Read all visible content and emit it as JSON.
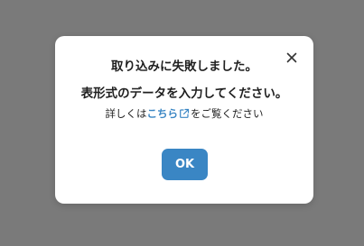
{
  "dialog": {
    "title": "取り込みに失敗しました。",
    "message": "表形式のデータを入力してください。",
    "detail_prefix": "詳しくは",
    "link_label": "こちら",
    "detail_suffix": "をご覧ください",
    "ok_label": "OK",
    "close_icon": "close-icon",
    "external_link_icon": "external-link-icon"
  },
  "colors": {
    "accent": "#3a86c4",
    "overlay": "#7a7a7a",
    "text": "#1f1f1f"
  }
}
